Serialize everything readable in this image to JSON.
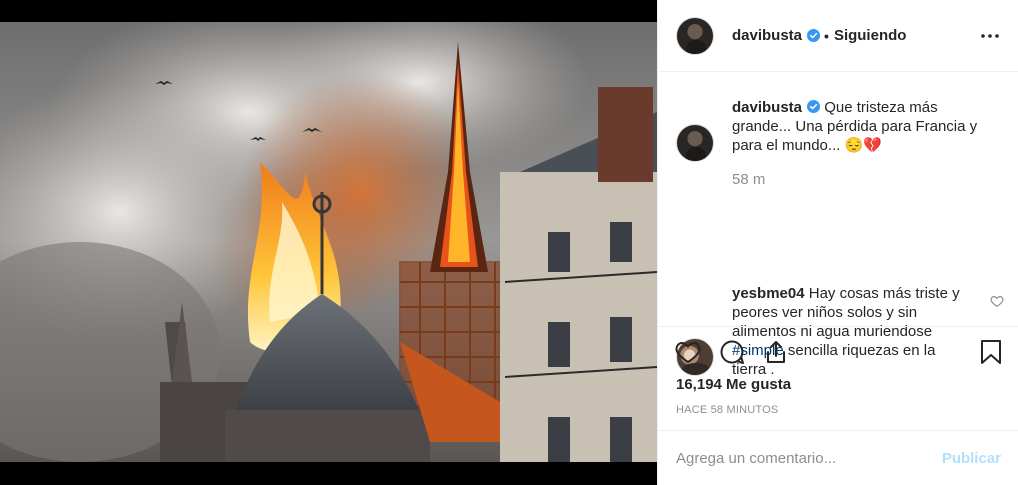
{
  "post": {
    "image_alt": "Fire at Notre-Dame cathedral"
  },
  "header": {
    "username": "davibusta",
    "verified_icon": "verified-badge-icon",
    "separator": "•",
    "follow_status": "Siguiendo",
    "more_icon": "more-options-icon"
  },
  "caption": {
    "username": "davibusta",
    "text": "Que tristeza más grande... Una pérdida para Francia y para el mundo... 😔💔",
    "time": "58 m"
  },
  "comment": {
    "username": "yesbme04",
    "text_before": "Hay cosas más triste y peores ver niños solos y sin alimentos ni agua muriendose",
    "hashtag": "#simple",
    "text_after": "sencilla riquezas en la tierra ."
  },
  "actions": {
    "like_icon": "heart-icon",
    "comment_icon": "comment-icon",
    "share_icon": "share-icon",
    "save_icon": "bookmark-icon"
  },
  "stats": {
    "likes": "16,194 Me gusta",
    "posted_ago": "HACE 58 MINUTOS"
  },
  "composer": {
    "placeholder": "Agrega un comentario...",
    "publish_label": "Publicar"
  },
  "colors": {
    "verified": "#3897f0",
    "link": "#003569",
    "publish_disabled": "#b2dffc",
    "muted": "#8e8e8e"
  }
}
